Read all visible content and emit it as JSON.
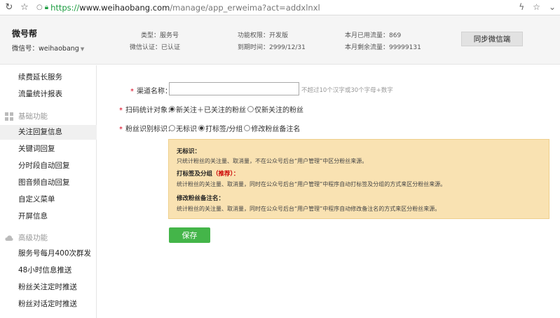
{
  "browser": {
    "url_protocol": "https://",
    "url_host": "www.weihaobang.com",
    "url_path": "/manage/app_erweima?act=addxlnxl"
  },
  "header": {
    "brand": "微号帮",
    "account_label": "微信号：weihaobang",
    "type_label": "类型：服务号",
    "auth_label": "微信认证：已认证",
    "permission_label": "功能权限：开发版",
    "expire_label": "到期时间：2999/12/31",
    "month_used_label": "本月已用流量：869",
    "month_left_label": "本月剩余流量：99999131",
    "sync_button": "同步微信端"
  },
  "sidebar": {
    "items_top": [
      "续费延长服务",
      "流量统计报表"
    ],
    "group_basic": "基础功能",
    "items_basic": [
      "关注回复信息",
      "关键词回复",
      "分时段自动回复",
      "图音频自动回复",
      "自定义菜单",
      "开屏信息"
    ],
    "group_advanced": "高级功能",
    "items_advanced": [
      "服务号每月400次群发",
      "48小时信息推送",
      "粉丝关注定时推送",
      "粉丝对话定时推送"
    ],
    "active": "关注回复信息"
  },
  "form": {
    "channel_label": "渠道名称：",
    "channel_value": "",
    "channel_hint": "不超过10个汉字或30个字母+数字",
    "scan_label": "扫码统计对象：",
    "scan_options": [
      "新关注＋已关注的粉丝",
      "仅新关注的粉丝"
    ],
    "scan_selected": 0,
    "identify_label": "粉丝识别标识：",
    "identify_options": [
      "无标识",
      "打标签/分组",
      "修改粉丝备注名"
    ],
    "identify_selected": 1,
    "save_button": "保存"
  },
  "note": {
    "t1": "无标识：",
    "d1": "只统计粉丝的关注量、取消量，不在公众号后台“用户管理”中区分粉丝来源。",
    "t2": "打标签及分组",
    "t2_rec": "（推荐）：",
    "d2": "统计粉丝的关注量、取消量，同时在公众号后台“用户管理”中程序自动打标签及分组的方式来区分粉丝来源。",
    "t3": "修改粉丝备注名：",
    "d3": "统计粉丝的关注量、取消量，同时在公众号后台“用户管理”中程序自动修改备注名的方式来区分粉丝来源。"
  },
  "colors": {
    "accent_green": "#44b549",
    "required_red": "#d9001b",
    "note_bg": "#f9e2b2"
  }
}
